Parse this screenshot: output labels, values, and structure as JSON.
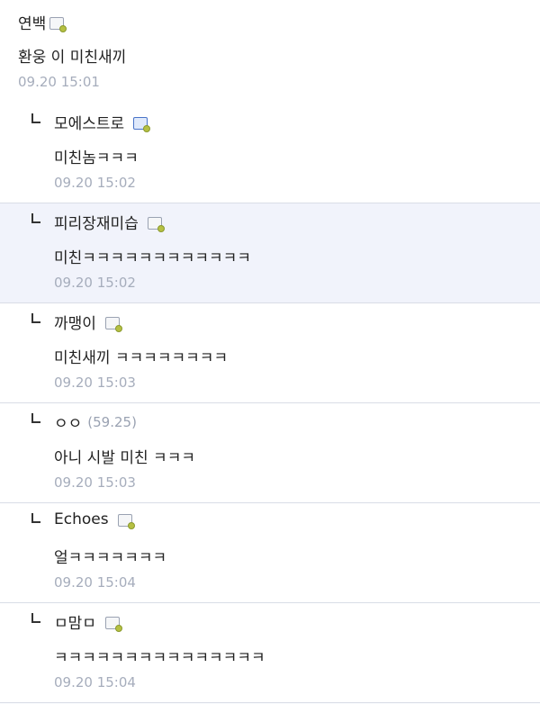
{
  "post": {
    "nick": "연백",
    "body": "환웅 이 미친새끼",
    "time": "09.20 15:01"
  },
  "replies": [
    {
      "nick": "모에스트로",
      "body": "미친놈ㅋㅋㅋ",
      "time": "09.20 15:02"
    },
    {
      "nick": "피리장재미습",
      "body": "미친ㅋㅋㅋㅋㅋㅋㅋㅋㅋㅋㅋㅋ",
      "time": "09.20 15:02"
    },
    {
      "nick": "까맹이",
      "body": "미친새끼 ㅋㅋㅋㅋㅋㅋㅋㅋ",
      "time": "09.20 15:03"
    },
    {
      "nick": "ㅇㅇ",
      "ip": "(59.25)",
      "body": "아니 시발 미친 ㅋㅋㅋ",
      "time": "09.20 15:03"
    },
    {
      "nick": "Echoes",
      "body": "얼ㅋㅋㅋㅋㅋㅋㅋ",
      "time": "09.20 15:04"
    },
    {
      "nick": "ㅁ맘ㅁ",
      "body": "ㅋㅋㅋㅋㅋㅋㅋㅋㅋㅋㅋㅋㅋㅋㅋ",
      "time": "09.20 15:04"
    }
  ],
  "icons": {
    "memo": "memo-icon",
    "reply_arrow": "reply-arrow-icon"
  },
  "colors": {
    "time": "#a6adbc",
    "border": "#d9dde6",
    "highlight": "#f1f3fb"
  }
}
